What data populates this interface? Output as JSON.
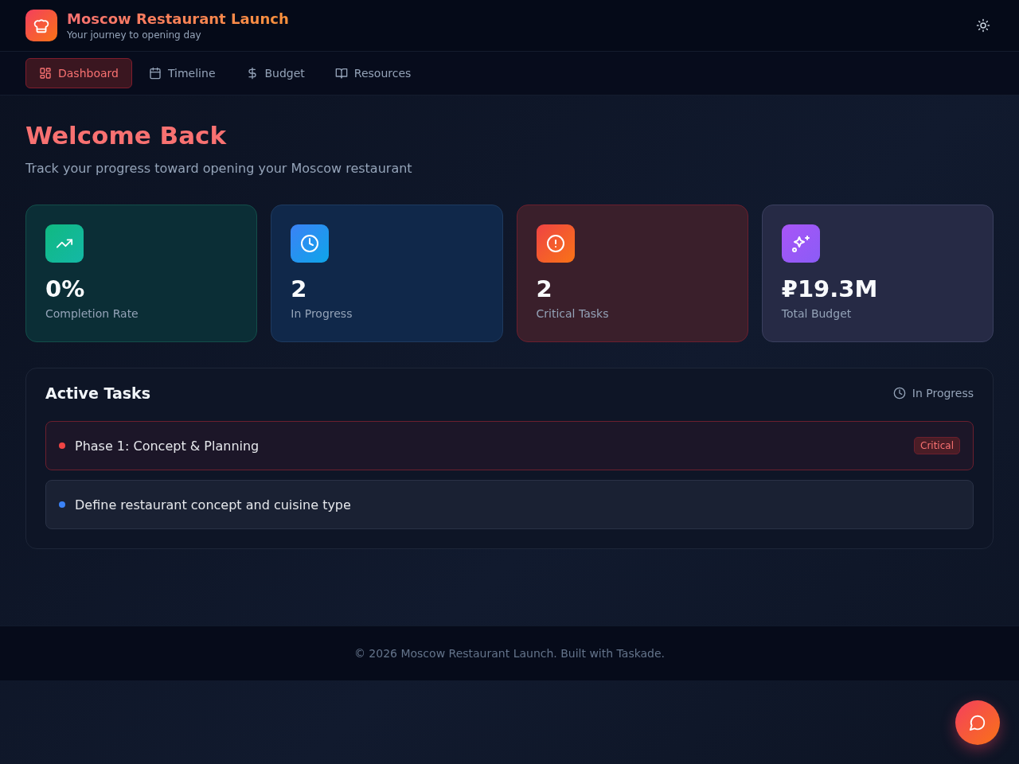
{
  "header": {
    "title": "Moscow Restaurant Launch",
    "subtitle": "Your journey to opening day"
  },
  "nav": [
    {
      "label": "Dashboard",
      "kind": "dashboard",
      "selected": true
    },
    {
      "label": "Timeline",
      "kind": "timeline",
      "selected": false
    },
    {
      "label": "Budget",
      "kind": "budget",
      "selected": false
    },
    {
      "label": "Resources",
      "kind": "resources",
      "selected": false
    }
  ],
  "welcome": {
    "title": "Welcome Back",
    "subtitle": "Track your progress toward opening your Moscow restaurant"
  },
  "stats": [
    {
      "kind": "completion",
      "value": "0%",
      "label": "Completion Rate"
    },
    {
      "kind": "progress",
      "value": "2",
      "label": "In Progress"
    },
    {
      "kind": "critical",
      "value": "2",
      "label": "Critical Tasks"
    },
    {
      "kind": "budget",
      "value": "₽19.3M",
      "label": "Total Budget"
    }
  ],
  "active_tasks": {
    "title": "Active Tasks",
    "filter": "In Progress",
    "tasks": [
      {
        "title": "Phase 1: Concept & Planning",
        "color": "#ef4444",
        "critical": true,
        "badge": "Critical"
      },
      {
        "title": "Define restaurant concept and cuisine type",
        "color": "#3b82f6",
        "critical": false
      }
    ]
  },
  "footer": "© 2026 Moscow Restaurant Launch. Built with Taskade."
}
